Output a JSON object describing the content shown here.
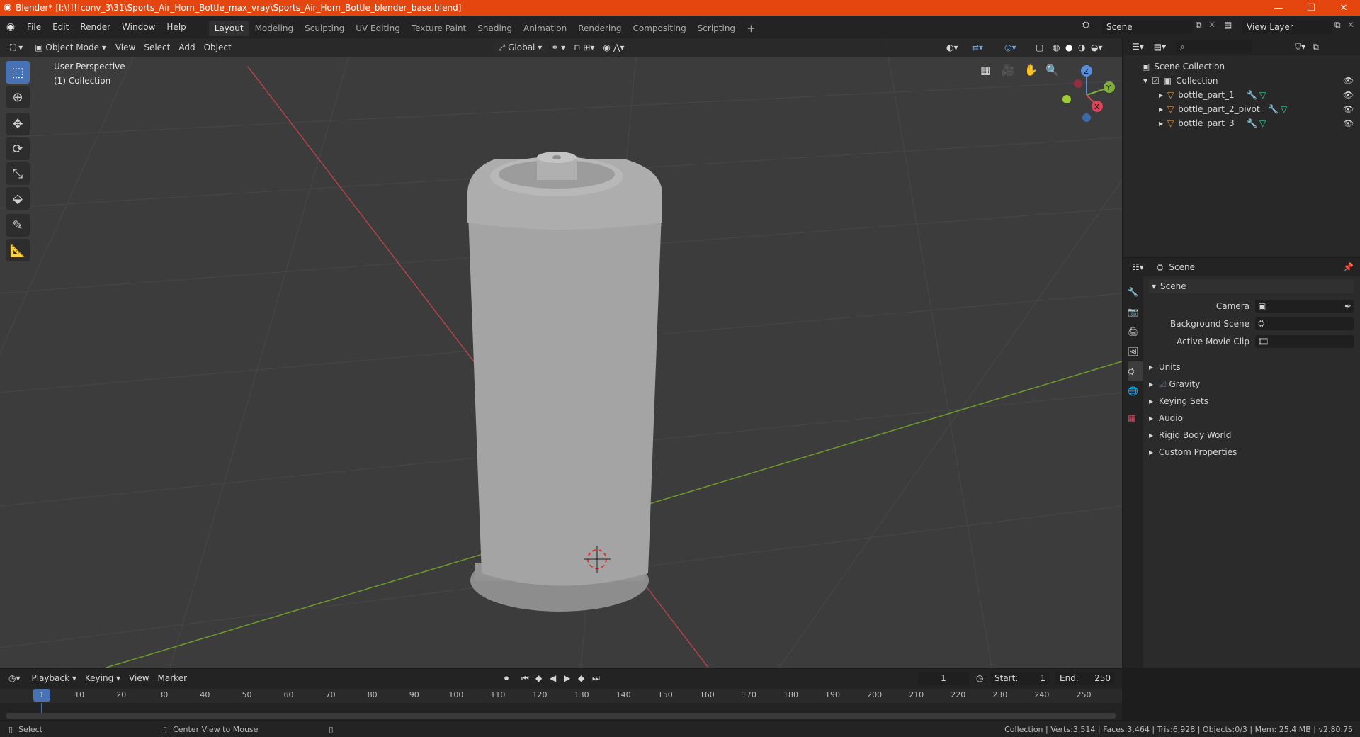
{
  "window": {
    "title": "Blender* [I:\\!!!!conv_3\\31\\Sports_Air_Horn_Bottle_max_vray\\Sports_Air_Horn_Bottle_blender_base.blend]",
    "minimize": "—",
    "restore": "❐",
    "close": "✕"
  },
  "menu": {
    "items": [
      "File",
      "Edit",
      "Render",
      "Window",
      "Help"
    ],
    "workspaces": [
      "Layout",
      "Modeling",
      "Sculpting",
      "UV Editing",
      "Texture Paint",
      "Shading",
      "Animation",
      "Rendering",
      "Compositing",
      "Scripting"
    ],
    "add_tab": "+",
    "scene_name": "Scene",
    "view_layer": "View Layer"
  },
  "viewport": {
    "mode": "Object Mode",
    "menus": [
      "View",
      "Select",
      "Add",
      "Object"
    ],
    "transform_orientation": "Global",
    "overlay_title": "User Perspective",
    "overlay_subtitle": "(1) Collection",
    "gizmo_axes": [
      "Z",
      "Y",
      "X"
    ],
    "colors": {
      "bg": "#3c3c3c",
      "x_axis": "#b2434b",
      "y_axis": "#6e9a2c",
      "grid": "#4a4a4a"
    }
  },
  "outliner": {
    "root": "Scene Collection",
    "collection": "Collection",
    "objects": [
      "bottle_part_1",
      "bottle_part_2_pivot",
      "bottle_part_3"
    ]
  },
  "properties": {
    "header_title": "Scene",
    "panel": "Scene",
    "fields": [
      {
        "label": "Camera"
      },
      {
        "label": "Background Scene"
      },
      {
        "label": "Active Movie Clip"
      }
    ],
    "subpanels": [
      "Units",
      "Gravity",
      "Keying Sets",
      "Audio",
      "Rigid Body World",
      "Custom Properties"
    ]
  },
  "timeline": {
    "menus": [
      "Playback",
      "Keying",
      "View",
      "Marker"
    ],
    "current_frame": "1",
    "start_label": "Start:",
    "start": "1",
    "end_label": "End:",
    "end": "250",
    "ticks": [
      "1",
      "10",
      "20",
      "30",
      "40",
      "50",
      "60",
      "70",
      "80",
      "90",
      "100",
      "110",
      "120",
      "130",
      "140",
      "150",
      "160",
      "170",
      "180",
      "190",
      "200",
      "210",
      "220",
      "230",
      "240",
      "250"
    ]
  },
  "status": {
    "left_action": "Select",
    "middle_action": "Center View to Mouse",
    "stats": "Collection | Verts:3,514 | Faces:3,464 | Tris:6,928 | Objects:0/3 | Mem: 25.4 MB | v2.80.75"
  }
}
